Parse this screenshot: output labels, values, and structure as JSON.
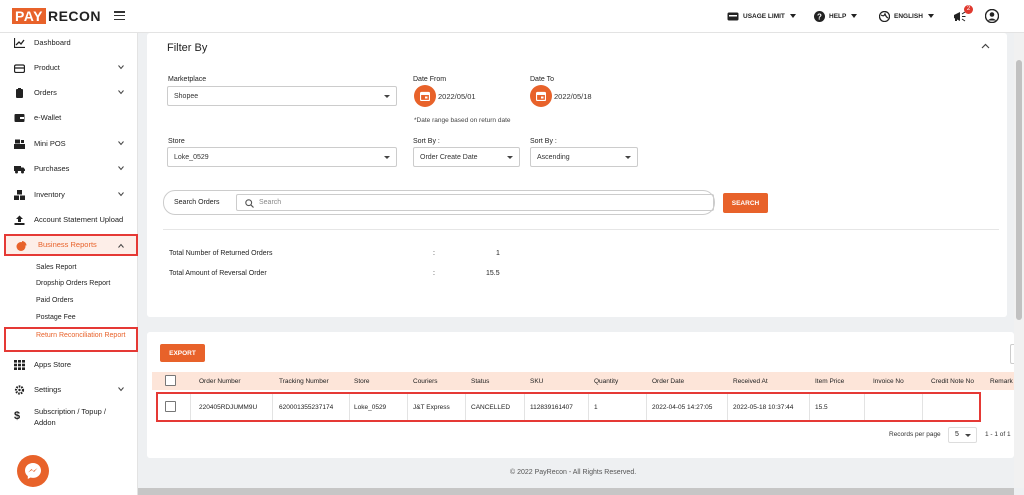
{
  "app": {
    "logo_pay": "PAY",
    "logo_recon": "RECON"
  },
  "topbar": {
    "usage_limit": "USAGE LIMIT",
    "help": "HELP",
    "language": "ENGLISH",
    "notification_count": "2"
  },
  "sidebar": {
    "items": [
      {
        "label": "Dashboard",
        "icon": "chart-line-icon"
      },
      {
        "label": "Product",
        "icon": "box-icon"
      },
      {
        "label": "Orders",
        "icon": "clipboard-icon"
      },
      {
        "label": "e-Wallet",
        "icon": "wallet-icon"
      },
      {
        "label": "Mini POS",
        "icon": "store-icon"
      },
      {
        "label": "Purchases",
        "icon": "truck-icon"
      },
      {
        "label": "Inventory",
        "icon": "boxes-icon"
      },
      {
        "label": "Account Statement Upload",
        "icon": "upload-icon"
      },
      {
        "label": "Business Reports",
        "icon": "pie-chart-icon"
      }
    ],
    "sub_items": [
      "Sales Report",
      "Dropship Orders Report",
      "Paid Orders",
      "Postage Fee"
    ],
    "sub_active": "Return Reconciliation Report",
    "bottom_items": [
      {
        "label": "Apps Store",
        "icon": "grid-icon"
      },
      {
        "label": "Settings",
        "icon": "gear-icon"
      },
      {
        "label": "Subscription / Topup /",
        "label2": "Addon",
        "icon": "dollar-icon"
      }
    ]
  },
  "filter": {
    "title": "Filter By",
    "marketplace_label": "Marketplace",
    "marketplace_value": "Shopee",
    "date_from_label": "Date From",
    "date_from_value": "2022/05/01",
    "date_to_label": "Date To",
    "date_to_value": "2022/05/18",
    "date_note": "*Date range based on return date",
    "store_label": "Store",
    "store_value": "Loke_0529",
    "sort_by_label_1": "Sort By :",
    "sort_by_value_1": "Order Create Date",
    "sort_by_label_2": "Sort By :",
    "sort_by_value_2": "Ascending",
    "search_label": "Search Orders",
    "search_placeholder": "Search",
    "search_button": "SEARCH"
  },
  "summary": {
    "returned_label": "Total Number of Returned Orders",
    "returned_value": "1",
    "reversal_label": "Total Amount of Reversal Order",
    "reversal_value": "15.5",
    "colon": ":"
  },
  "table": {
    "export_label": "EXPORT",
    "headers": [
      "Order Number",
      "Tracking Number",
      "Store",
      "Couriers",
      "Status",
      "SKU",
      "Quantity",
      "Order Date",
      "Received At",
      "Item Price",
      "Invoice No",
      "Credit Note No",
      "Remark"
    ],
    "rows": [
      [
        "220405RDJUMM9U",
        "620001355237174",
        "Loke_0529",
        "J&T Express",
        "CANCELLED",
        "112839161407",
        "1",
        "2022-04-05 14:27:05",
        "2022-05-18 10:37:44",
        "15.5",
        "",
        ""
      ]
    ],
    "records_per_page_label": "Records per page",
    "records_per_page": "5",
    "range": "1 - 1 of 1"
  },
  "footer": {
    "text": "© 2022 PayRecon - All Rights Reserved."
  },
  "colors": {
    "accent": "#e8622a",
    "highlight": "#e53935",
    "header_bg": "#fde5d9"
  }
}
